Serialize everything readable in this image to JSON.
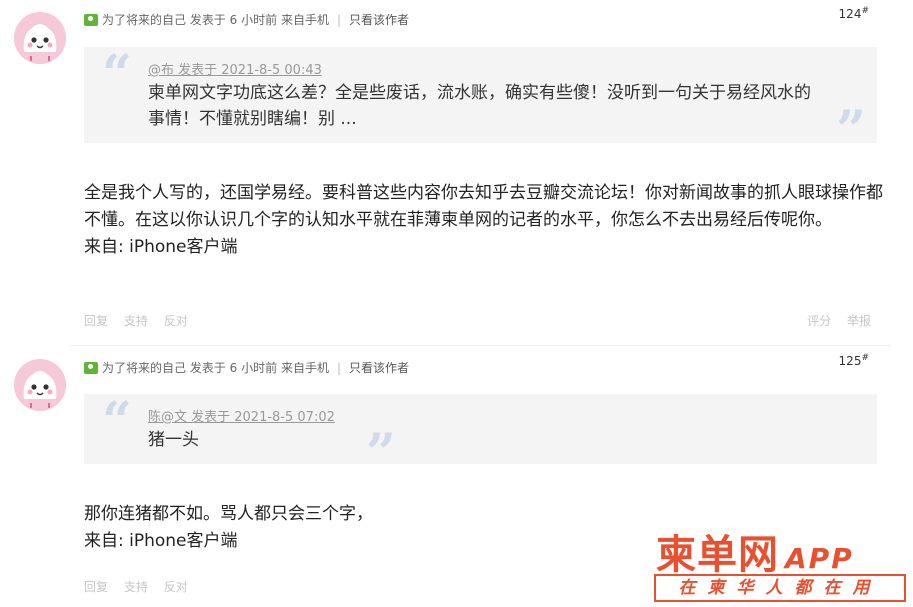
{
  "posts": [
    {
      "meta": {
        "username": "为了将来的自己",
        "posted": "发表于 6 小时前",
        "source": "来自手机",
        "separator": "|",
        "only_author": "只看该作者"
      },
      "floor": "124",
      "floor_mark": "#",
      "quote": {
        "author": "@布 发表于 2021-8-5 00:43",
        "text": "柬单网文字功底这么差？全是些废话，流水账，确实有些傻！没听到一句关于易经风水的事情！不懂就别瞎编！别 ..."
      },
      "content": "全是我个人写的，还国学易经。要科普这些内容你去知乎去豆瓣交流论坛！你对新闻故事的抓人眼球操作都不懂。在这以你认识几个字的认知水平就在菲薄柬单网的记者的水平，你怎么不去出易经后传呢你。",
      "client": "来自: iPhone客户端",
      "actions": {
        "reply": "回复",
        "support": "支持",
        "oppose": "反对",
        "rate": "评分",
        "report": "举报"
      }
    },
    {
      "meta": {
        "username": "为了将来的自己",
        "posted": "发表于 6 小时前",
        "source": "来自手机",
        "separator": "|",
        "only_author": "只看该作者"
      },
      "floor": "125",
      "floor_mark": "#",
      "quote": {
        "author": "陈@文 发表于 2021-8-5 07:02",
        "text": "猪一头"
      },
      "content": "那你连猪都不如。骂人都只会三个字，",
      "client": "来自: iPhone客户端",
      "actions": {
        "reply": "回复",
        "support": "支持",
        "oppose": "反对"
      }
    }
  ],
  "watermark": {
    "brand": "柬单网",
    "app": "APP",
    "slogan": "在柬华人都在用"
  },
  "colors": {
    "quote_bg": "#f4f4f4",
    "quote_mark": "#cfdbe8",
    "brand_red": "#e8502f",
    "online_green": "#5fb536"
  }
}
